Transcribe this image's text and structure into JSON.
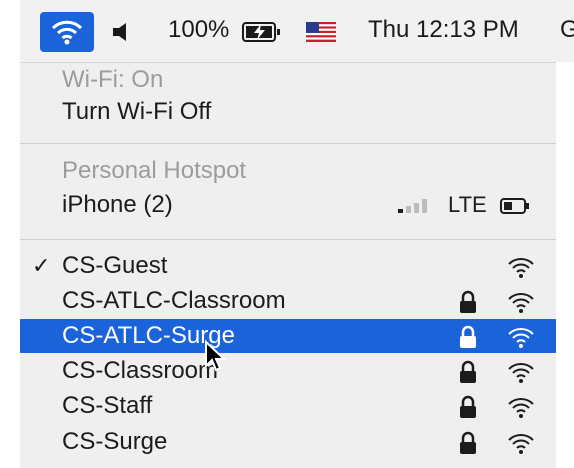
{
  "menubar": {
    "battery_percent": "100%",
    "clock": "Thu 12:13 PM",
    "user_partial": "Gr",
    "icons": [
      "wifi-icon",
      "speaker-icon",
      "battery-charging-icon",
      "us-flag-icon"
    ]
  },
  "wifi_section": {
    "status": "Wi-Fi: On",
    "toggle_label": "Turn Wi-Fi Off"
  },
  "hotspot_section": {
    "header": "Personal Hotspot",
    "device": "iPhone (2)",
    "network_type": "LTE"
  },
  "networks": [
    {
      "name": "CS-Guest",
      "checked": true,
      "locked": false,
      "selected": false
    },
    {
      "name": "CS-ATLC-Classroom",
      "checked": false,
      "locked": true,
      "selected": false
    },
    {
      "name": "CS-ATLC-Surge",
      "checked": false,
      "locked": true,
      "selected": true
    },
    {
      "name": "CS-Classroom",
      "checked": false,
      "locked": true,
      "selected": false
    },
    {
      "name": "CS-Staff",
      "checked": false,
      "locked": true,
      "selected": false
    },
    {
      "name": "CS-Surge",
      "checked": false,
      "locked": true,
      "selected": false
    }
  ],
  "colors": {
    "accent": "#1b63d9",
    "menu_bg": "#efefef",
    "dim_text": "#9c9c9c"
  }
}
